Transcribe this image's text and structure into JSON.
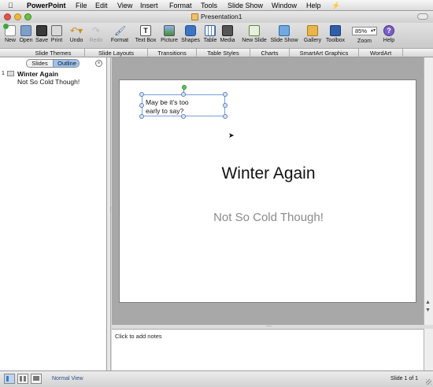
{
  "menubar": {
    "app": "PowerPoint",
    "items": [
      "File",
      "Edit",
      "View",
      "Insert",
      "Format",
      "Tools",
      "Slide Show",
      "Window",
      "Help"
    ]
  },
  "window": {
    "title": "Presentation1"
  },
  "toolbar": {
    "items": [
      {
        "label": "New",
        "icon": "new-icon"
      },
      {
        "label": "Open",
        "icon": "open-icon"
      },
      {
        "label": "Save",
        "icon": "save-icon"
      },
      {
        "label": "Print",
        "icon": "print-icon"
      },
      {
        "label": "Undo",
        "icon": "undo-icon"
      },
      {
        "label": "Redo",
        "icon": "redo-icon"
      },
      {
        "label": "Format",
        "icon": "format-icon"
      },
      {
        "label": "Text Box",
        "icon": "text-box-icon"
      },
      {
        "label": "Picture",
        "icon": "picture-icon"
      },
      {
        "label": "Shapes",
        "icon": "shapes-icon"
      },
      {
        "label": "Table",
        "icon": "table-icon"
      },
      {
        "label": "Media",
        "icon": "media-icon"
      },
      {
        "label": "New Slide",
        "icon": "new-slide-icon"
      },
      {
        "label": "Slide Show",
        "icon": "slide-show-icon"
      },
      {
        "label": "Gallery",
        "icon": "gallery-icon"
      },
      {
        "label": "Toolbox",
        "icon": "toolbox-icon"
      },
      {
        "label": "Zoom",
        "icon": "zoom-icon"
      },
      {
        "label": "Help",
        "icon": "help-icon"
      }
    ],
    "zoom_value": "85%"
  },
  "ribbon": {
    "tabs": [
      "Slide Themes",
      "Slide Layouts",
      "Transitions",
      "Table Styles",
      "Charts",
      "SmartArt Graphics",
      "WordArt"
    ]
  },
  "left_pane": {
    "tab_slides": "Slides",
    "tab_outline": "Outline",
    "slide_number": "1",
    "outline_title": "Winter Again",
    "outline_subtitle": "Not So Cold Though!"
  },
  "slide": {
    "textbox_text": "May be it’s too early to say?",
    "title": "Winter Again",
    "subtitle": "Not So Cold Though!"
  },
  "notes": {
    "placeholder": "Click to add notes"
  },
  "statusbar": {
    "view_label": "Normal View",
    "slide_counter": "Slide 1 of 1"
  },
  "colors": {
    "accent": "#4a78c4",
    "selection": "#5a7fbf",
    "title_text": "#111111",
    "subtitle_text": "#8a8a8a"
  }
}
